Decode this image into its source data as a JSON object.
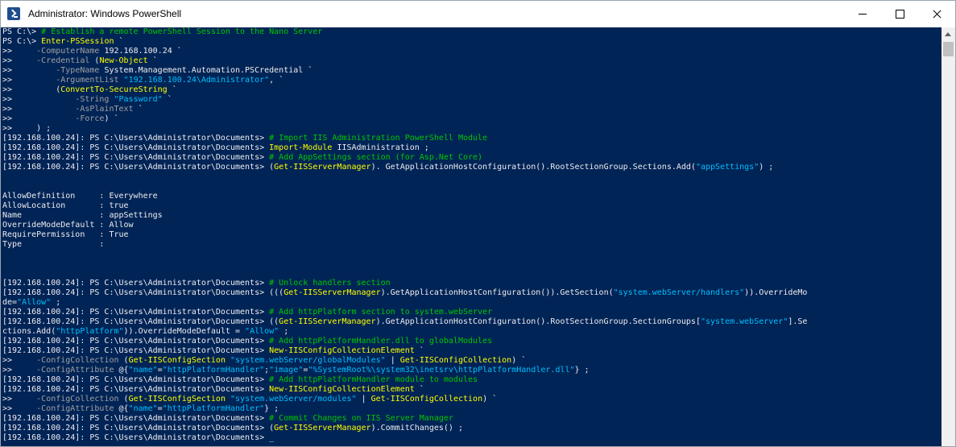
{
  "window": {
    "title": "Administrator: Windows PowerShell",
    "icon": "powershell-icon",
    "controls": {
      "minimize": "minimize-icon",
      "maximize": "maximize-icon",
      "close": "close-icon"
    }
  },
  "colors": {
    "console_bg": "#012456",
    "default_text": "#eeedf0",
    "command": "#ffff00",
    "string": "#00bfff",
    "parameter": "#a0a0a0",
    "comment": "#00c800"
  },
  "console": {
    "lines": [
      [
        [
          "def",
          "PS C:\\> "
        ],
        [
          "cmt",
          "# Establish a remote PowerShell Session to the Nano Server"
        ]
      ],
      [
        [
          "def",
          "PS C:\\> "
        ],
        [
          "cmd",
          "Enter-PSSession"
        ],
        [
          "def",
          " `"
        ]
      ],
      [
        [
          "def",
          ">>     "
        ],
        [
          "par",
          "-ComputerName"
        ],
        [
          "def",
          " 192.168.100.24 `"
        ]
      ],
      [
        [
          "def",
          ">>     "
        ],
        [
          "par",
          "-Credential"
        ],
        [
          "def",
          " ("
        ],
        [
          "cmd",
          "New-Object"
        ],
        [
          "def",
          " `"
        ]
      ],
      [
        [
          "def",
          ">>         "
        ],
        [
          "par",
          "-TypeName"
        ],
        [
          "def",
          " System.Management.Automation.PSCredential `"
        ]
      ],
      [
        [
          "def",
          ">>         "
        ],
        [
          "par",
          "-ArgumentList"
        ],
        [
          "def",
          " "
        ],
        [
          "str",
          "\"192.168.100.24\\Administrator\""
        ],
        [
          "def",
          ", `"
        ]
      ],
      [
        [
          "def",
          ">>         ("
        ],
        [
          "cmd",
          "ConvertTo-SecureString"
        ],
        [
          "def",
          " `"
        ]
      ],
      [
        [
          "def",
          ">>             "
        ],
        [
          "par",
          "-String"
        ],
        [
          "def",
          " "
        ],
        [
          "str",
          "\"Password\""
        ],
        [
          "def",
          " `"
        ]
      ],
      [
        [
          "def",
          ">>             "
        ],
        [
          "par",
          "-AsPlainText"
        ],
        [
          "def",
          " `"
        ]
      ],
      [
        [
          "def",
          ">>             "
        ],
        [
          "par",
          "-Force"
        ],
        [
          "def",
          ") `"
        ]
      ],
      [
        [
          "def",
          ">>     ) ;"
        ]
      ],
      [
        [
          "def",
          "[192.168.100.24]: PS C:\\Users\\Administrator\\Documents> "
        ],
        [
          "cmt",
          "# Import IIS Administration PowerShell Module"
        ]
      ],
      [
        [
          "def",
          "[192.168.100.24]: PS C:\\Users\\Administrator\\Documents> "
        ],
        [
          "cmd",
          "Import-Module"
        ],
        [
          "def",
          " IISAdministration ;"
        ]
      ],
      [
        [
          "def",
          "[192.168.100.24]: PS C:\\Users\\Administrator\\Documents> "
        ],
        [
          "cmt",
          "# Add AppSettings section (for Asp.Net Core)"
        ]
      ],
      [
        [
          "def",
          "[192.168.100.24]: PS C:\\Users\\Administrator\\Documents> ("
        ],
        [
          "cmd",
          "Get-IISServerManager"
        ],
        [
          "def",
          "). GetApplicationHostConfiguration().RootSectionGroup.Sections.Add("
        ],
        [
          "str",
          "\"appSettings\""
        ],
        [
          "def",
          ") ;"
        ]
      ],
      [
        [
          "def",
          ""
        ]
      ],
      [
        [
          "def",
          ""
        ]
      ],
      [
        [
          "def",
          "AllowDefinition     : Everywhere"
        ]
      ],
      [
        [
          "def",
          "AllowLocation       : true"
        ]
      ],
      [
        [
          "def",
          "Name                : appSettings"
        ]
      ],
      [
        [
          "def",
          "OverrideModeDefault : Allow"
        ]
      ],
      [
        [
          "def",
          "RequirePermission   : True"
        ]
      ],
      [
        [
          "def",
          "Type                :"
        ]
      ],
      [
        [
          "def",
          ""
        ]
      ],
      [
        [
          "def",
          ""
        ]
      ],
      [
        [
          "def",
          ""
        ]
      ],
      [
        [
          "def",
          "[192.168.100.24]: PS C:\\Users\\Administrator\\Documents> "
        ],
        [
          "cmt",
          "# Unlock handlers section"
        ]
      ],
      [
        [
          "def",
          "[192.168.100.24]: PS C:\\Users\\Administrator\\Documents> ((("
        ],
        [
          "cmd",
          "Get-IISServerManager"
        ],
        [
          "def",
          ").GetApplicationHostConfiguration()).GetSection("
        ],
        [
          "str",
          "\"system.webServer/handlers\""
        ],
        [
          "def",
          ")).OverrideMo"
        ]
      ],
      [
        [
          "def",
          "de="
        ],
        [
          "str",
          "\"Allow\""
        ],
        [
          "def",
          " ;"
        ]
      ],
      [
        [
          "def",
          "[192.168.100.24]: PS C:\\Users\\Administrator\\Documents> "
        ],
        [
          "cmt",
          "# Add httpPlatform section to system.webServer"
        ]
      ],
      [
        [
          "def",
          "[192.168.100.24]: PS C:\\Users\\Administrator\\Documents> (("
        ],
        [
          "cmd",
          "Get-IISServerManager"
        ],
        [
          "def",
          ").GetApplicationHostConfiguration().RootSectionGroup.SectionGroups["
        ],
        [
          "str",
          "\"system.webServer\""
        ],
        [
          "def",
          "].Se"
        ]
      ],
      [
        [
          "def",
          "ctions.Add("
        ],
        [
          "str",
          "\"httpPlatform\""
        ],
        [
          "def",
          ")).OverrideModeDefault = "
        ],
        [
          "str",
          "\"Allow\""
        ],
        [
          "def",
          " ;"
        ]
      ],
      [
        [
          "def",
          "[192.168.100.24]: PS C:\\Users\\Administrator\\Documents> "
        ],
        [
          "cmt",
          "# Add httpPlatformHandler.dll to globalModules"
        ]
      ],
      [
        [
          "def",
          "[192.168.100.24]: PS C:\\Users\\Administrator\\Documents> "
        ],
        [
          "cmd",
          "New-IISConfigCollectionElement"
        ],
        [
          "def",
          " `"
        ]
      ],
      [
        [
          "def",
          ">>     "
        ],
        [
          "par",
          "-ConfigCollection"
        ],
        [
          "def",
          " ("
        ],
        [
          "cmd",
          "Get-IISConfigSection"
        ],
        [
          "def",
          " "
        ],
        [
          "str",
          "\"system.webServer/globalModules\""
        ],
        [
          "def",
          " | "
        ],
        [
          "cmd",
          "Get-IISConfigCollection"
        ],
        [
          "def",
          ") `"
        ]
      ],
      [
        [
          "def",
          ">>     "
        ],
        [
          "par",
          "-ConfigAttribute"
        ],
        [
          "def",
          " @{"
        ],
        [
          "str",
          "\"name\""
        ],
        [
          "def",
          "="
        ],
        [
          "str",
          "\"httpPlatformHandler\""
        ],
        [
          "def",
          ";"
        ],
        [
          "str",
          "\"image\""
        ],
        [
          "def",
          "="
        ],
        [
          "str",
          "\"%SystemRoot%\\system32\\inetsrv\\httpPlatformHandler.dll\""
        ],
        [
          "def",
          "} ;"
        ]
      ],
      [
        [
          "def",
          "[192.168.100.24]: PS C:\\Users\\Administrator\\Documents> "
        ],
        [
          "cmt",
          "# Add httpPlatformHandler module to modules"
        ]
      ],
      [
        [
          "def",
          "[192.168.100.24]: PS C:\\Users\\Administrator\\Documents> "
        ],
        [
          "cmd",
          "New-IISConfigCollectionElement"
        ],
        [
          "def",
          " `"
        ]
      ],
      [
        [
          "def",
          ">>     "
        ],
        [
          "par",
          "-ConfigCollection"
        ],
        [
          "def",
          " ("
        ],
        [
          "cmd",
          "Get-IISConfigSection"
        ],
        [
          "def",
          " "
        ],
        [
          "str",
          "\"system.webServer/modules\""
        ],
        [
          "def",
          " | "
        ],
        [
          "cmd",
          "Get-IISConfigCollection"
        ],
        [
          "def",
          ") `"
        ]
      ],
      [
        [
          "def",
          ">>     "
        ],
        [
          "par",
          "-ConfigAttribute"
        ],
        [
          "def",
          " @{"
        ],
        [
          "str",
          "\"name\""
        ],
        [
          "def",
          "="
        ],
        [
          "str",
          "\"httpPlatformHandler\""
        ],
        [
          "def",
          "} ;"
        ]
      ],
      [
        [
          "def",
          "[192.168.100.24]: PS C:\\Users\\Administrator\\Documents> "
        ],
        [
          "cmt",
          "# Commit Changes on IIS Server Manager"
        ]
      ],
      [
        [
          "def",
          "[192.168.100.24]: PS C:\\Users\\Administrator\\Documents> ("
        ],
        [
          "cmd",
          "Get-IISServerManager"
        ],
        [
          "def",
          ").CommitChanges() ;"
        ]
      ],
      [
        [
          "def",
          "[192.168.100.24]: PS C:\\Users\\Administrator\\Documents> "
        ],
        [
          "cursor",
          "_"
        ]
      ]
    ]
  }
}
